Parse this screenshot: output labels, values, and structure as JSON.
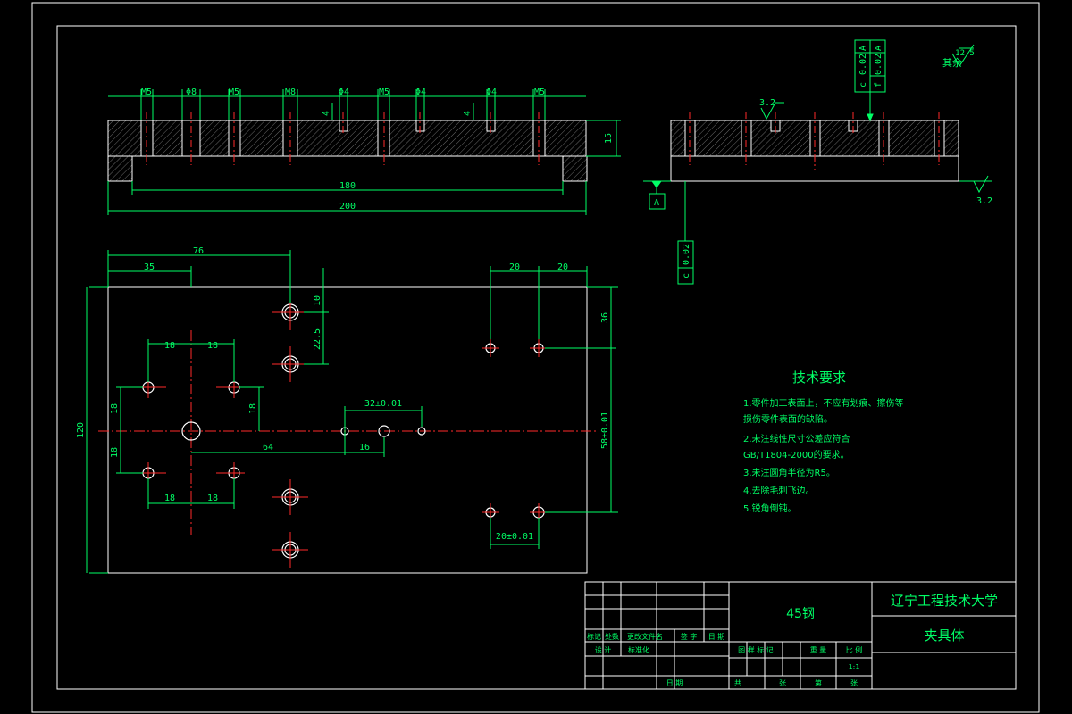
{
  "top_labels": [
    "M5",
    "Φ8",
    "M5",
    "M8",
    "Φ4",
    "M5",
    "Φ4",
    "Φ4",
    "M5"
  ],
  "front_view": {
    "dim_180": "180",
    "dim_200": "200",
    "dim_15": "15",
    "small_dims": [
      "4",
      "4"
    ]
  },
  "side_view": {
    "roughness_3_2": "3.2",
    "roughness_bottom": "3.2",
    "datum_label": "A",
    "tol_c": "c",
    "tol_c_val": "0.02",
    "tol_f": "f",
    "tol_f_val": "0.02",
    "tol_f_datum": "A",
    "tol_c_bottom": "c",
    "tol_c_bottom_val": "0.02",
    "other_label": "其余",
    "other_roughness": "12.5"
  },
  "plan_view": {
    "d76": "76",
    "d35": "35",
    "d20a": "20",
    "d20b": "20",
    "d10": "10",
    "d22_5": "22.5",
    "d36": "36",
    "d18_1": "18",
    "d18_2": "18",
    "d18_v1": "18",
    "d18_v2": "18",
    "d18_v3": "18",
    "d18_3": "18",
    "d18_4": "18",
    "d32": "32±0.01",
    "d64": "64",
    "d16": "16",
    "d120": "120",
    "d58": "58±0.01",
    "d20_tol": "20±0.01"
  },
  "requirements": {
    "title": "技术要求",
    "lines": [
      "1.零件加工表面上，不应有划痕、擦伤等",
      "  损伤零件表面的缺陷。",
      "2.未注线性尺寸公差应符合",
      "  GB/T1804-2000的要求。",
      "3.未注圆角半径为R5。",
      "4.去除毛刺飞边。",
      "5.锐角倒钝。"
    ]
  },
  "title_block": {
    "material": "45钢",
    "university": "辽宁工程技术大学",
    "part_name": "夹具体",
    "scale": "1:1",
    "row_labels": [
      "标记",
      "处数",
      "更改文件名",
      "签 字",
      "日 期"
    ],
    "design_label": "设 计",
    "standard_label": "标准化",
    "stage_labels": [
      "图 样 标 记",
      "重 量",
      "比 例"
    ],
    "sheet_labels": [
      "共",
      "张",
      "第",
      "张"
    ],
    "approve_label": "日 期"
  },
  "colors": {
    "outline": "#ffffff",
    "dimension": "#00ff66",
    "center": "#ff2a2a",
    "hatch": "#5a5a5a"
  }
}
